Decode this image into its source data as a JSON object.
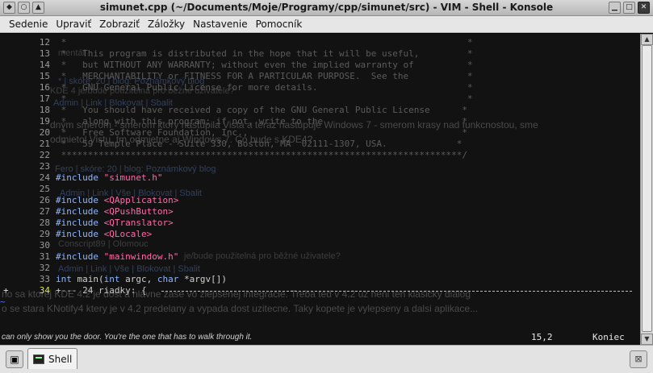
{
  "window": {
    "title": "simunet.cpp (~/Documents/Moje/Programy/cpp/simunet/src) - VIM - Shell - Konsole"
  },
  "menu": [
    "Sedenie",
    "Upraviť",
    "Zobraziť",
    "Záložky",
    "Nastavenie",
    "Pomocník"
  ],
  "editor": {
    "lines": [
      {
        "num": "12",
        "segments": [
          {
            "t": " *                                                                           *",
            "c": "comment"
          }
        ]
      },
      {
        "num": "13",
        "segments": [
          {
            "t": " *   This program is distributed in the hope that it will be useful,         *",
            "c": "comment"
          }
        ]
      },
      {
        "num": "14",
        "segments": [
          {
            "t": " *   but WITHOUT ANY WARRANTY; without even the implied warranty of          *",
            "c": "comment"
          }
        ]
      },
      {
        "num": "15",
        "segments": [
          {
            "t": " *   MERCHANTABILITY or FITNESS FOR A PARTICULAR PURPOSE.  See the           *",
            "c": "comment"
          }
        ]
      },
      {
        "num": "16",
        "segments": [
          {
            "t": " *   GNU General Public License for more details.                            *",
            "c": "comment"
          }
        ]
      },
      {
        "num": "17",
        "segments": [
          {
            "t": " *                                                                           *",
            "c": "comment"
          }
        ]
      },
      {
        "num": "18",
        "segments": [
          {
            "t": " *   You should have received a copy of the GNU General Public License      *",
            "c": "comment"
          }
        ]
      },
      {
        "num": "19",
        "segments": [
          {
            "t": " *   along with this program; if not, write to the                          *",
            "c": "comment"
          }
        ]
      },
      {
        "num": "20",
        "segments": [
          {
            "t": " *   Free Software Foundation, Inc.,                                        *",
            "c": "comment"
          }
        ]
      },
      {
        "num": "21",
        "segments": [
          {
            "t": " *   59 Temple Place - Suite 330, Boston, MA  02111-1307, USA.             *",
            "c": "comment"
          }
        ]
      },
      {
        "num": "22",
        "segments": [
          {
            "t": " ***************************************************************************/",
            "c": "comment"
          }
        ]
      },
      {
        "num": "23",
        "segments": []
      },
      {
        "num": "24",
        "segments": [
          {
            "t": "#include ",
            "c": "kw"
          },
          {
            "t": "\"simunet.h\"",
            "c": "str"
          }
        ]
      },
      {
        "num": "25",
        "segments": []
      },
      {
        "num": "26",
        "segments": [
          {
            "t": "#include ",
            "c": "kw"
          },
          {
            "t": "<QApplication>",
            "c": "str"
          }
        ]
      },
      {
        "num": "27",
        "segments": [
          {
            "t": "#include ",
            "c": "kw"
          },
          {
            "t": "<QPushButton>",
            "c": "str"
          }
        ]
      },
      {
        "num": "28",
        "segments": [
          {
            "t": "#include ",
            "c": "kw"
          },
          {
            "t": "<QTranslator>",
            "c": "str"
          }
        ]
      },
      {
        "num": "29",
        "segments": [
          {
            "t": "#include ",
            "c": "kw"
          },
          {
            "t": "<QLocale>",
            "c": "str"
          }
        ]
      },
      {
        "num": "30",
        "segments": []
      },
      {
        "num": "31",
        "segments": [
          {
            "t": "#include ",
            "c": "kw"
          },
          {
            "t": "\"mainwindow.h\"",
            "c": "str"
          }
        ]
      },
      {
        "num": "32",
        "segments": []
      },
      {
        "num": "33",
        "segments": [
          {
            "t": "int",
            "c": "type"
          },
          {
            "t": " main(",
            "c": "plain"
          },
          {
            "t": "int",
            "c": "type"
          },
          {
            "t": " argc, ",
            "c": "plain"
          },
          {
            "t": "char",
            "c": "type"
          },
          {
            "t": " *argv[])",
            "c": "plain"
          }
        ]
      }
    ],
    "fold_line": {
      "num": "34",
      "text": "+--- 24 riadky: {"
    },
    "tilde": "~"
  },
  "status": {
    "message": "can only show you the door. You're the one that has to walk through it.",
    "position": "15,2",
    "mode": "Koniec"
  },
  "tabs": [
    {
      "label": "Shell"
    }
  ],
  "ghost": {
    "l1": "mentáŕ",
    "l2": "* | skóre: 20 | blog: Poznámkový blog",
    "l3": "KDE 4 je/bude použitelná pro běžné uživatele?",
    "l4": "Admin | Link | Blokovat | Sbalit",
    "l5": "dným smerom - smerom ktory nastupila Vista a teraz nastupuje Windows 7 - smerom krasy nad funkcnostou, sme",
    "l6": "odmietol Vistu, tm odmietne aj Windows 7. Co bude s KDE4?",
    "l7": "Fero | skóre: 20 | blog: Poznámkový blog",
    "l8": "Admin | Link | Vše | Blokovat | Sbalit",
    "l9": "Conscript89 | Olomouc",
    "l10": "je/bude použitelná pro běžné uživatele?",
    "l11": "Admin | Link | Vše | Blokovat | Sbalit",
    "l12": "no sa ktorej KDE 4.2 je dost a hlavne zase vo zlepsenej integracie. Treba ted v 4.2 uz neni ten klasicky dialog",
    "l13": "o se stara KNotify4 ktery je v 4.2 predelany a vypada dost uzitecne. Taky kopete je vylepseny a dalsi aplikace..."
  }
}
